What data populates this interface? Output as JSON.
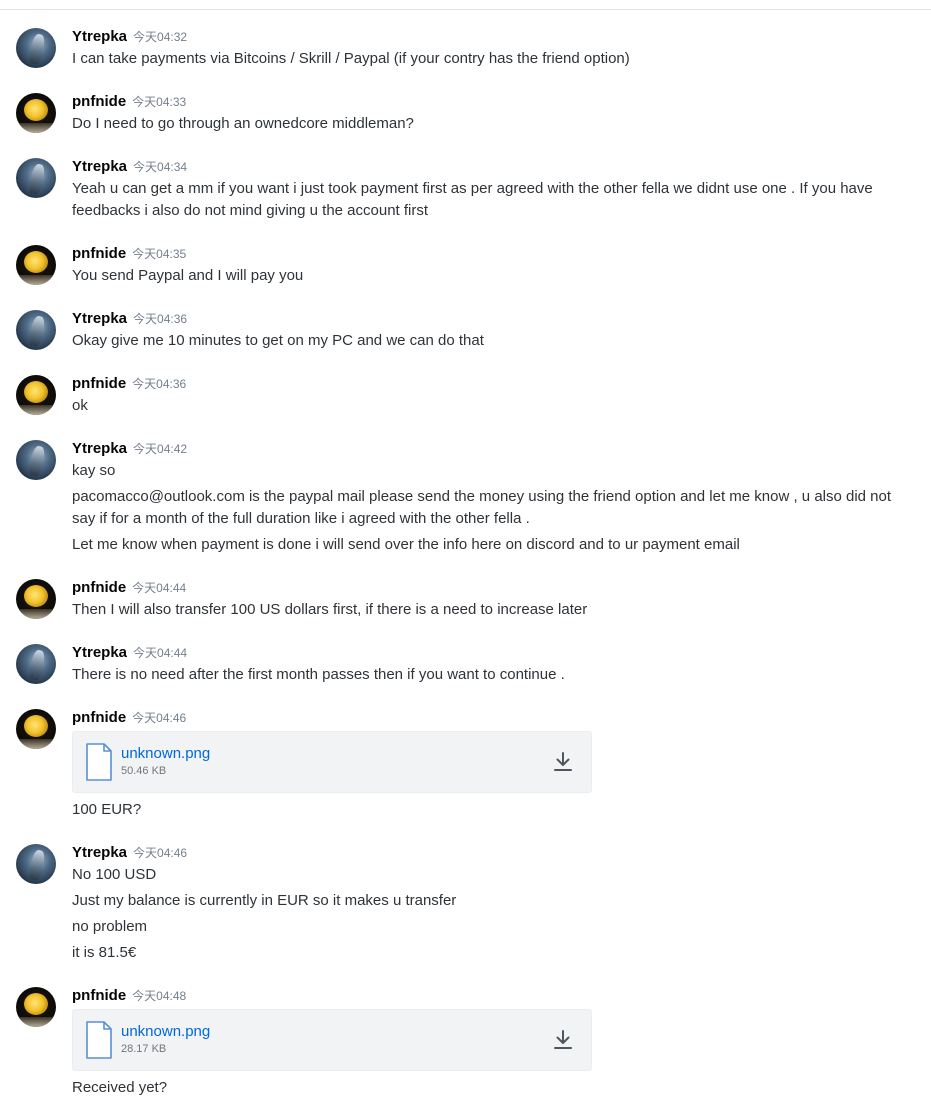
{
  "messages": [
    {
      "author": "Ytrepka",
      "avatar": "armored-figure-avatar",
      "time": "今天04:32",
      "lines": [
        "I can take payments via Bitcoins / Skrill / Paypal (if your contry has the friend option)"
      ]
    },
    {
      "author": "pnfnide",
      "avatar": "gold-coin-avatar",
      "time": "今天04:33",
      "lines": [
        "Do I need to go through an ownedcore middleman?"
      ]
    },
    {
      "author": "Ytrepka",
      "avatar": "armored-figure-avatar",
      "time": "今天04:34",
      "lines": [
        "Yeah u can get a mm if you want i just took payment first as per agreed with the other fella we didnt use one . If you have",
        "feedbacks i also do not mind giving u the account first"
      ]
    },
    {
      "author": "pnfnide",
      "avatar": "gold-coin-avatar",
      "time": "今天04:35",
      "lines": [
        "You send Paypal and I will pay you"
      ]
    },
    {
      "author": "Ytrepka",
      "avatar": "armored-figure-avatar",
      "time": "今天04:36",
      "lines": [
        "Okay give me 10 minutes to get on my PC and we can do that"
      ]
    },
    {
      "author": "pnfnide",
      "avatar": "gold-coin-avatar",
      "time": "今天04:36",
      "lines": [
        "ok"
      ]
    },
    {
      "author": "Ytrepka",
      "avatar": "armored-figure-avatar",
      "time": "今天04:42",
      "lines": [
        "kay so",
        "pacomacco@outlook.com is the paypal mail please send the money using the friend option and let me know , u also did not",
        "say if for a month of the full duration like i agreed with the other fella .",
        "Let me know when payment is done i will send over the info here on discord and to ur payment email"
      ]
    },
    {
      "author": "pnfnide",
      "avatar": "gold-coin-avatar",
      "time": "今天04:44",
      "lines": [
        "Then I will also transfer 100 US dollars first, if there is a need to increase later"
      ]
    },
    {
      "author": "Ytrepka",
      "avatar": "armored-figure-avatar",
      "time": "今天04:44",
      "lines": [
        "There is no need after the first month passes then if you want to continue ."
      ]
    },
    {
      "author": "pnfnide",
      "avatar": "gold-coin-avatar",
      "time": "今天04:46",
      "attachment": {
        "name": "unknown.png",
        "size": "50.46 KB"
      },
      "lines": [
        "100 EUR?"
      ]
    },
    {
      "author": "Ytrepka",
      "avatar": "armored-figure-avatar",
      "time": "今天04:46",
      "lines": [
        "No 100 USD",
        "Just my balance is currently in EUR so it makes u transfer",
        "no problem",
        "it is 81.5€"
      ]
    },
    {
      "author": "pnfnide",
      "avatar": "gold-coin-avatar",
      "time": "今天04:48",
      "attachment": {
        "name": "unknown.png",
        "size": "28.17 KB"
      },
      "lines": [
        "Received yet?"
      ]
    }
  ],
  "colors": {
    "link": "#0068e0",
    "timestamp": "#747f8d",
    "author": "#060607",
    "text": "#2e3338",
    "attachment_bg": "#f2f3f5"
  }
}
